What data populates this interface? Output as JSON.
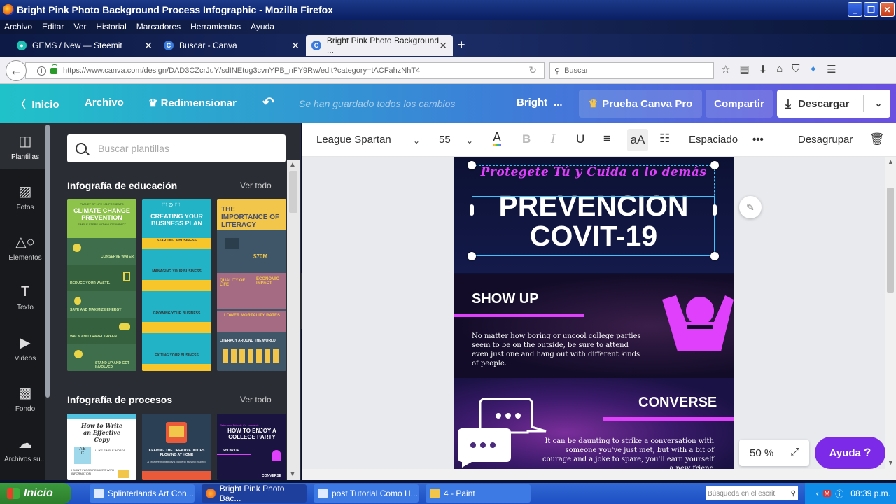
{
  "window": {
    "title": "Bright Pink Photo Background Process Infographic - Mozilla Firefox"
  },
  "menu": [
    "Archivo",
    "Editar",
    "Ver",
    "Historial",
    "Marcadores",
    "Herramientas",
    "Ayuda"
  ],
  "tabs": [
    {
      "label": "GEMS / New — Steemit",
      "icon": "steemit-icon"
    },
    {
      "label": "Buscar - Canva",
      "icon": "canva-icon"
    },
    {
      "label": "Bright Pink Photo Background ...",
      "icon": "canva-icon"
    }
  ],
  "nav": {
    "url": "https://www.canva.com/design/DAD3CZcrJuY/sdINEtug3cvnYPB_nFY9Rw/edit?category=tACFahzNhT4",
    "search_placeholder": "Buscar"
  },
  "canva_header": {
    "home": "Inicio",
    "file": "Archivo",
    "resize": "Redimensionar",
    "saved": "Se han guardado todos los cambios",
    "doc_title": "Bright",
    "ellipsis": "...",
    "pro": "Prueba Canva Pro",
    "share": "Compartir",
    "download": "Descargar"
  },
  "rail": [
    "Plantillas",
    "Fotos",
    "Elementos",
    "Texto",
    "Videos",
    "Fondo",
    "Archivos su..."
  ],
  "panel": {
    "search_placeholder": "Buscar plantillas",
    "section1": {
      "title": "Infografía de educación",
      "see_all": "Ver todo"
    },
    "section2": {
      "title": "Infografía de procesos",
      "see_all": "Ver todo"
    },
    "thumbs1": [
      {
        "title": "CLIMATE CHANGE PREVENTION",
        "top": "PLANET OF LIFE 101 PRESENTS",
        "sub": "SIMPLE STEPS WITH HUGE IMPACT",
        "items": [
          "CONSERVE WATER.",
          "REDUCE YOUR WASTE.",
          "SAVE AND MAXIMIZE ENERGY",
          "WALK AND TRAVEL GREEN",
          "STAND UP AND GET INVOLVED"
        ]
      },
      {
        "title": "CREATING YOUR BUSINESS PLAN",
        "items": [
          "STARTING A BUSINESS",
          "MANAGING YOUR BUSINESS",
          "GROWING YOUR BUSINESS",
          "EXITING YOUR BUSINESS"
        ]
      },
      {
        "title": "THE IMPORTANCE OF LITERACY",
        "value": "$70M",
        "labels": [
          "QUALITY OF LIFE",
          "ECONOMIC IMPACT",
          "LOWER MORTALITY RATES",
          "LITERACY AROUND THE WORLD"
        ]
      }
    ],
    "thumbs2": [
      {
        "title": "How to Write an Effective Copy",
        "items": [
          "A",
          "B",
          "C",
          "I LIKE SIMPLE WORDS",
          "I DON'T FLOOD READERS WITH INFORMATION"
        ]
      },
      {
        "title": "KEEPING THE CREATIVE JUICES FLOWING AT HOME",
        "sub": "A creative homebody's guide to staying inspired"
      },
      {
        "title": "HOW TO ENJOY A COLLEGE PARTY",
        "top": "Peter and Friends Co. presents",
        "items": [
          "SHOW UP",
          "CONVERSE"
        ]
      }
    ]
  },
  "toolbar": {
    "font": "League Spartan",
    "size": "55",
    "spacing": "Espaciado",
    "ungroup": "Desagrupar"
  },
  "design": {
    "script": "Protegete Tú y Cuida a lo demás",
    "title1": "PREVENCION",
    "title2": "COVIT-19",
    "sec1_head": "SHOW UP",
    "sec1_text": "No matter how boring or uncool college parties seem to be on the outside, be sure to attend even just one and hang out with different kinds of people.",
    "sec2_head": "CONVERSE",
    "sec2_text": "It can be daunting to strike a conversation with someone you've just met, but with a bit of courage and a joke to spare, you'll earn yourself a new friend",
    "accent": "#e040fb"
  },
  "zoom": "50 %",
  "help": "Ayuda",
  "help_q": "?",
  "taskbar": {
    "start": "Inicio",
    "tasks": [
      "Splinterlands Art Con...",
      "Bright Pink Photo Bac...",
      "post Tutorial Como H...",
      "4 - Paint"
    ],
    "search_placeholder": "Búsqueda en el escrit",
    "time": "08:39 p.m."
  }
}
